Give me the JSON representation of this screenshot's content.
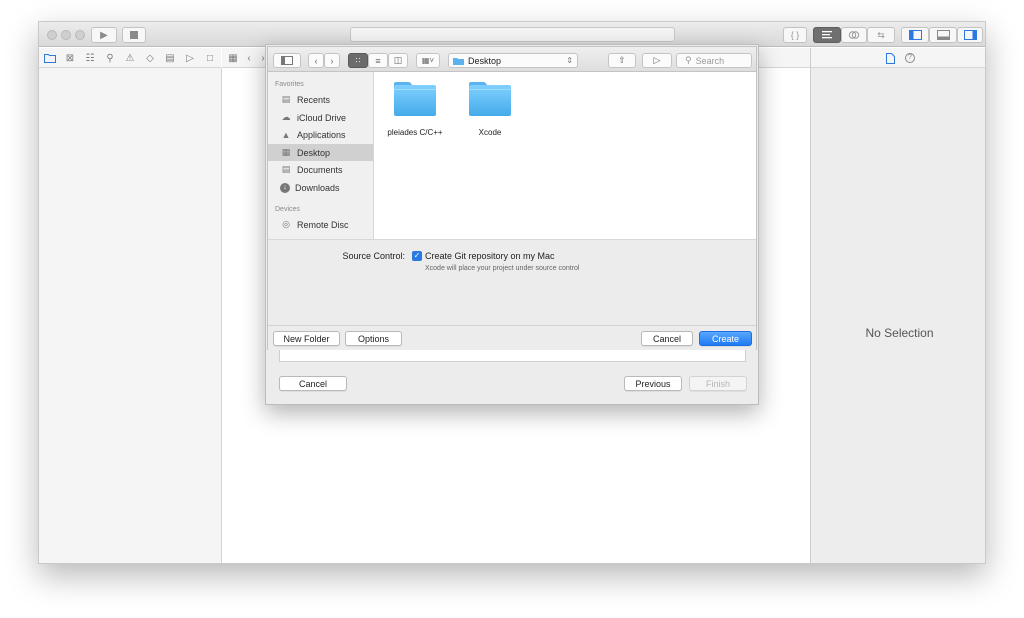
{
  "toolbar": {
    "run_icon": "play-icon",
    "stop_icon": "stop-icon",
    "editor_standard_icon": "text-align-icon",
    "editor_assistant_icon": "interlocking-rings-icon",
    "editor_version_icon": "arrows-swap-icon",
    "nav_toggle_icon": "left-panel-icon",
    "debug_toggle_icon": "bottom-panel-icon",
    "util_toggle_icon": "right-panel-icon"
  },
  "inspector": {
    "no_selection": "No Selection"
  },
  "save_panel": {
    "location": "Desktop",
    "search_placeholder": "Search",
    "sidebar": {
      "favorites_header": "Favorites",
      "favorites": [
        {
          "label": "Recents",
          "icon": "clock-icon"
        },
        {
          "label": "iCloud Drive",
          "icon": "cloud-icon"
        },
        {
          "label": "Applications",
          "icon": "applications-icon"
        },
        {
          "label": "Desktop",
          "icon": "desktop-icon"
        },
        {
          "label": "Documents",
          "icon": "document-icon"
        },
        {
          "label": "Downloads",
          "icon": "download-icon"
        }
      ],
      "devices_header": "Devices",
      "devices": [
        {
          "label": "Remote Disc",
          "icon": "disc-icon"
        }
      ]
    },
    "folders": [
      {
        "name": "pleiades C/C++"
      },
      {
        "name": "Xcode"
      }
    ],
    "source_control_label": "Source Control:",
    "git_checkbox_label": "Create Git repository on my Mac",
    "git_checked": true,
    "git_hint": "Xcode will place your project under source control",
    "new_folder": "New Folder",
    "options": "Options",
    "cancel": "Cancel",
    "create": "Create"
  },
  "sheet": {
    "cancel": "Cancel",
    "previous": "Previous",
    "finish": "Finish"
  },
  "colors": {
    "accent": "#1f7bf5",
    "folder": "#5ab2ef",
    "selected_row": "#d0d0d0"
  }
}
